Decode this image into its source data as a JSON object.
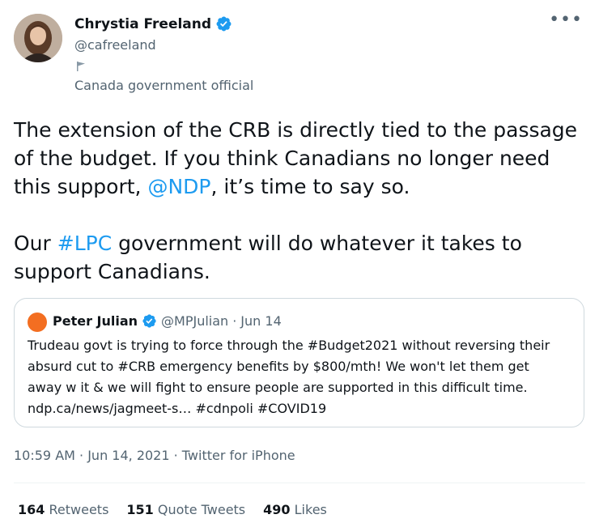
{
  "author": {
    "display_name": "Chrystia Freeland",
    "handle": "@cafreeland",
    "label": "Canada government official"
  },
  "tweet": {
    "para1_before": "The extension of the CRB is directly tied to the passage of the budget. If you think Canadians no longer need this support, ",
    "para1_mention": "@NDP",
    "para1_after": ", it’s time to say so.",
    "para2_before": "Our ",
    "para2_hashtag": "#LPC",
    "para2_after": " government will do whatever it takes to support Canadians."
  },
  "quote": {
    "display_name": "Peter Julian",
    "handle": "@MPJulian",
    "separator": "·",
    "date": "Jun 14",
    "lines": [
      "Trudeau govt is trying to force through the #Budget2021 without reversing their",
      "absurd cut to #CRB emergency benefits by $800/mth! We won't let them get",
      "away w it & we will fight to ensure people are supported in this difficult time.",
      "ndp.ca/news/jagmeet-s… #cdnpoli #COVID19"
    ]
  },
  "timestamp": "10:59 AM · Jun 14, 2021 · Twitter for iPhone",
  "stats": {
    "retweets_count": "164",
    "retweets_label": "Retweets",
    "quotes_count": "151",
    "quotes_label": "Quote Tweets",
    "likes_count": "490",
    "likes_label": "Likes"
  },
  "more_icon": "more-horizontal-icon",
  "colors": {
    "link": "#1d9bf0",
    "verified": "#1d9bf0",
    "muted": "#536471",
    "quote_avatar": "#f36e21"
  }
}
